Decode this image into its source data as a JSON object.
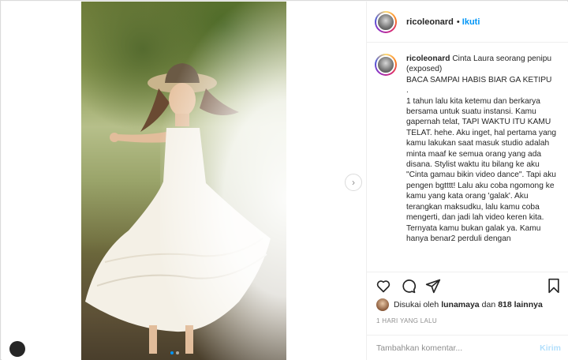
{
  "post": {
    "username": "ricoleonard",
    "separator": "•",
    "follow_label": "Ikuti",
    "caption": {
      "username": "ricoleonard",
      "lines": [
        "Cinta Laura seorang penipu (exposed)",
        "BACA SAMPAI HABIS BIAR GA KETIPU",
        ".",
        "1 tahun lalu kita ketemu dan berkarya bersama untuk suatu instansi. Kamu gapernah telat, TAPI WAKTU ITU KAMU TELAT. hehe. Aku inget, hal pertama yang kamu lakukan saat masuk studio adalah minta maaf ke semua orang yang ada disana. Stylist waktu itu bilang ke aku \"Cinta gamau bikin video dance\". Tapi aku pengen bgtttt! Lalu aku coba ngomong ke kamu yang kata orang 'galak'. Aku terangkan maksudku, lalu kamu coba mengerti, dan jadi lah video keren kita. Ternyata kamu bukan galak ya. Kamu hanya benar2 perduli dengan"
      ]
    },
    "likes": {
      "prefix": "Disukai oleh",
      "user": "lunamaya",
      "middle": "dan",
      "others": "818 lainnya"
    },
    "time_ago": "1 HARI YANG LALU",
    "comment_placeholder": "Tambahkan komentar...",
    "post_button": "Kirim"
  },
  "carousel": {
    "next_icon": "chevron-right-icon",
    "slides_total": 2,
    "active_slide": 1
  },
  "icons": {
    "like": "heart-icon",
    "comment": "comment-icon",
    "share": "paper-plane-icon",
    "save": "bookmark-icon"
  },
  "colors": {
    "accent": "#0095f6",
    "text": "#262626",
    "muted": "#8e8e8e",
    "post_disabled": "#b2dffc"
  }
}
